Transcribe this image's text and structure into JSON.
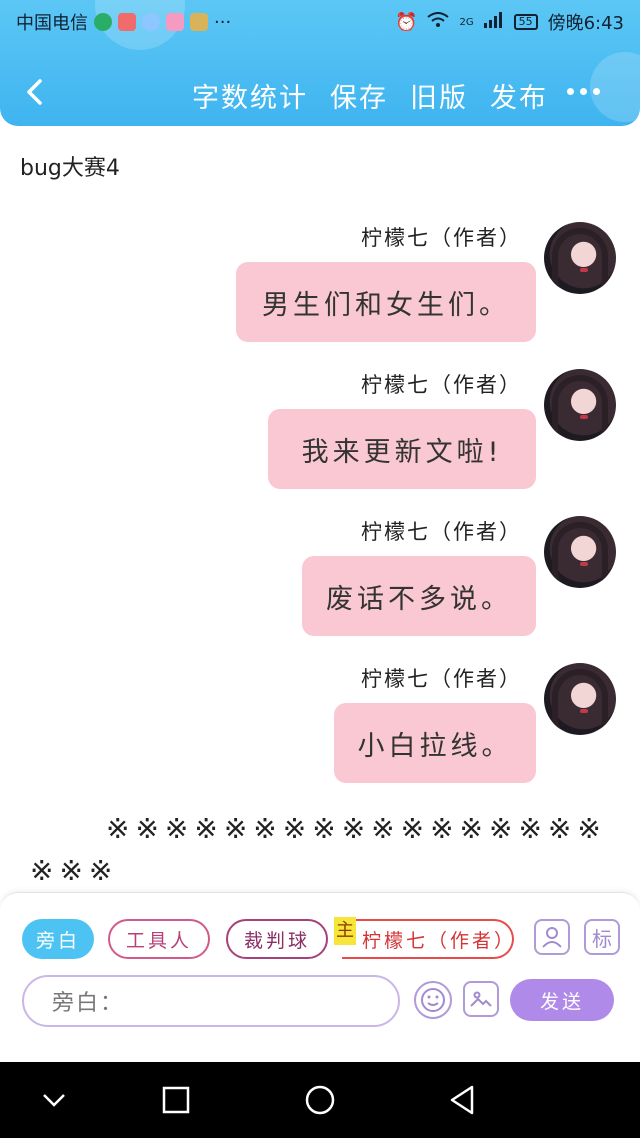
{
  "status_bar": {
    "carrier": "中国电信",
    "network": "2G",
    "battery": "55",
    "time": "傍晚6:43",
    "more": "···"
  },
  "nav": {
    "actions": [
      "字数统计",
      "保存",
      "旧版",
      "发布"
    ]
  },
  "document": {
    "title": "bug大赛4"
  },
  "messages": [
    {
      "author": "柠檬七（作者）",
      "text": "男生们和女生们。"
    },
    {
      "author": "柠檬七（作者）",
      "text": "我来更新文啦!"
    },
    {
      "author": "柠檬七（作者）",
      "text": "废话不多说。"
    },
    {
      "author": "柠檬七（作者）",
      "text": "小白拉线。"
    }
  ],
  "narration_marks": "※※※※※※※※※※※※※※※※※※※※",
  "composer": {
    "roles": [
      "旁白",
      "工具人",
      "裁判球",
      "柠檬七（作者）"
    ],
    "main_tag": "主",
    "tag_icon_label": "标",
    "input_prefix": "旁白：",
    "send_label": "发送"
  },
  "colors": {
    "header": "#3fb4f0",
    "bubble": "#f9c8d2",
    "accent": "#b08ae8"
  }
}
